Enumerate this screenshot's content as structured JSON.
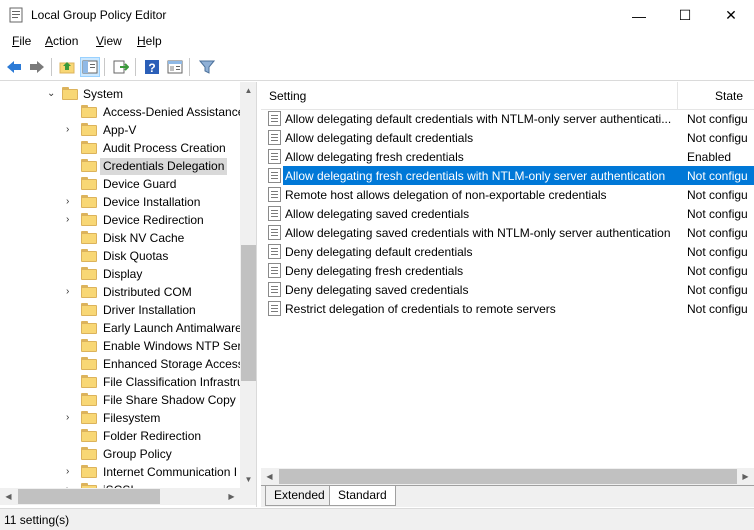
{
  "window": {
    "title": "Local Group Policy Editor",
    "minimize_glyph": "—",
    "maximize_glyph": "☐",
    "close_glyph": "✕"
  },
  "menu": [
    {
      "label": "File",
      "accel": "F",
      "rest": "ile"
    },
    {
      "label": "Action",
      "accel": "A",
      "rest": "ction"
    },
    {
      "label": "View",
      "accel": "V",
      "rest": "iew"
    },
    {
      "label": "Help",
      "accel": "H",
      "rest": "elp"
    }
  ],
  "toolbar": {
    "icons": [
      "back-arrow-icon",
      "forward-arrow-icon",
      "up-folder-icon",
      "show-hide-tree-icon",
      "export-list-icon",
      "help-icon",
      "properties-icon",
      "filter-icon"
    ],
    "accent": "#2b7ad6"
  },
  "tree": {
    "parent": "System",
    "items": [
      {
        "label": "Access-Denied Assistance",
        "expandable": false
      },
      {
        "label": "App-V",
        "expandable": true
      },
      {
        "label": "Audit Process Creation",
        "expandable": false
      },
      {
        "label": "Credentials Delegation",
        "expandable": false,
        "selected": true
      },
      {
        "label": "Device Guard",
        "expandable": false
      },
      {
        "label": "Device Installation",
        "expandable": true
      },
      {
        "label": "Device Redirection",
        "expandable": true
      },
      {
        "label": "Disk NV Cache",
        "expandable": false
      },
      {
        "label": "Disk Quotas",
        "expandable": false
      },
      {
        "label": "Display",
        "expandable": false
      },
      {
        "label": "Distributed COM",
        "expandable": true
      },
      {
        "label": "Driver Installation",
        "expandable": false
      },
      {
        "label": "Early Launch Antimalware",
        "expandable": false
      },
      {
        "label": "Enable Windows NTP Serv",
        "expandable": false
      },
      {
        "label": "Enhanced Storage Access",
        "expandable": false
      },
      {
        "label": "File Classification Infrastru",
        "expandable": false
      },
      {
        "label": "File Share Shadow Copy P",
        "expandable": false
      },
      {
        "label": "Filesystem",
        "expandable": true
      },
      {
        "label": "Folder Redirection",
        "expandable": false
      },
      {
        "label": "Group Policy",
        "expandable": false
      },
      {
        "label": "Internet Communication I",
        "expandable": true
      },
      {
        "label": "iSCSI",
        "expandable": true
      }
    ]
  },
  "list": {
    "columns": {
      "setting": "Setting",
      "state": "State"
    },
    "rows": [
      {
        "setting": "Allow delegating default credentials with NTLM-only server authenticati...",
        "state": "Not configu"
      },
      {
        "setting": "Allow delegating default credentials",
        "state": "Not configu"
      },
      {
        "setting": "Allow delegating fresh credentials",
        "state": "Enabled"
      },
      {
        "setting": "Allow delegating fresh credentials with NTLM-only server authentication",
        "state": "Not configu",
        "selected": true
      },
      {
        "setting": "Remote host allows delegation of non-exportable credentials",
        "state": "Not configu"
      },
      {
        "setting": "Allow delegating saved credentials",
        "state": "Not configu"
      },
      {
        "setting": "Allow delegating saved credentials with NTLM-only server authentication",
        "state": "Not configu"
      },
      {
        "setting": "Deny delegating default credentials",
        "state": "Not configu"
      },
      {
        "setting": "Deny delegating fresh credentials",
        "state": "Not configu"
      },
      {
        "setting": "Deny delegating saved credentials",
        "state": "Not configu"
      },
      {
        "setting": "Restrict delegation of credentials to remote servers",
        "state": "Not configu"
      }
    ]
  },
  "tabs": [
    {
      "label": "Extended",
      "active": false
    },
    {
      "label": "Standard",
      "active": true
    }
  ],
  "status": {
    "text": "11 setting(s)"
  }
}
